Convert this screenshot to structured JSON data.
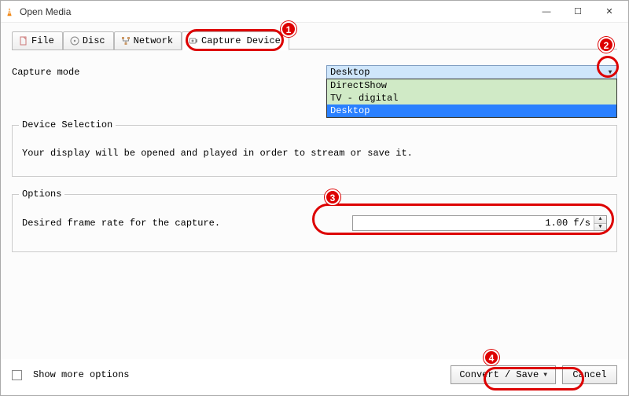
{
  "window": {
    "title": "Open Media",
    "controls": {
      "min": "—",
      "max": "☐",
      "close": "✕"
    }
  },
  "tabs": {
    "file": "File",
    "disc": "Disc",
    "network": "Network",
    "capture": "Capture Device"
  },
  "capture_mode": {
    "label": "Capture mode",
    "selected": "Desktop",
    "options": [
      "DirectShow",
      "TV - digital",
      "Desktop"
    ]
  },
  "device_selection": {
    "legend": "Device Selection",
    "text": "Your display will be opened and played in order to stream or save it."
  },
  "options": {
    "legend": "Options",
    "fps_label": "Desired frame rate for the capture.",
    "fps_value": "1.00 f/s"
  },
  "show_more": "Show more options",
  "buttons": {
    "convert": "Convert / Save",
    "cancel": "Cancel"
  },
  "annotations": {
    "n1": "1",
    "n2": "2",
    "n3": "3",
    "n4": "4"
  }
}
